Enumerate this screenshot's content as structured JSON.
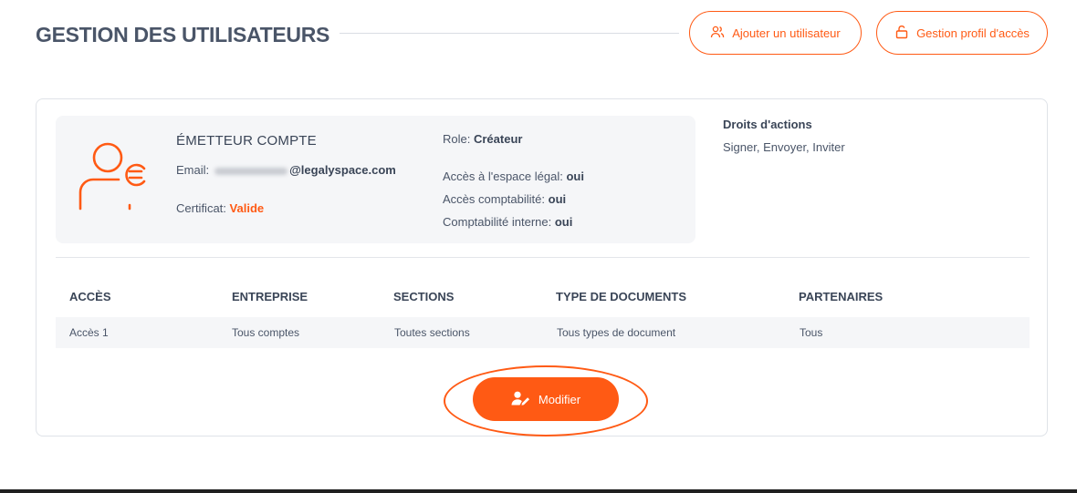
{
  "header": {
    "title": "GESTION DES UTILISATEURS",
    "add_user_label": "Ajouter un utilisateur",
    "access_profile_label": "Gestion profil d'accès",
    "accent_color": "#ff5a14"
  },
  "account": {
    "title": "ÉMETTEUR COMPTE",
    "email_label": "Email:",
    "email_domain": "@legalyspace.com",
    "certificate_label": "Certificat:",
    "certificate_value": "Valide",
    "role_label": "Role:",
    "role_value": "Créateur",
    "legal_space_label": "Accès à l'espace légal:",
    "legal_space_value": "oui",
    "accounting_label": "Accès comptabilité:",
    "accounting_value": "oui",
    "internal_accounting_label": "Comptabilité interne:",
    "internal_accounting_value": "oui"
  },
  "rights": {
    "title": "Droits d'actions",
    "value": "Signer, Envoyer, Inviter"
  },
  "table": {
    "columns": [
      "ACCÈS",
      "ENTREPRISE",
      "SECTIONS",
      "TYPE DE DOCUMENTS",
      "PARTENAIRES"
    ],
    "rows": [
      [
        "Accès 1",
        "Tous comptes",
        "Toutes sections",
        "Tous types de document",
        "Tous"
      ]
    ]
  },
  "actions": {
    "modify_label": "Modifier"
  }
}
